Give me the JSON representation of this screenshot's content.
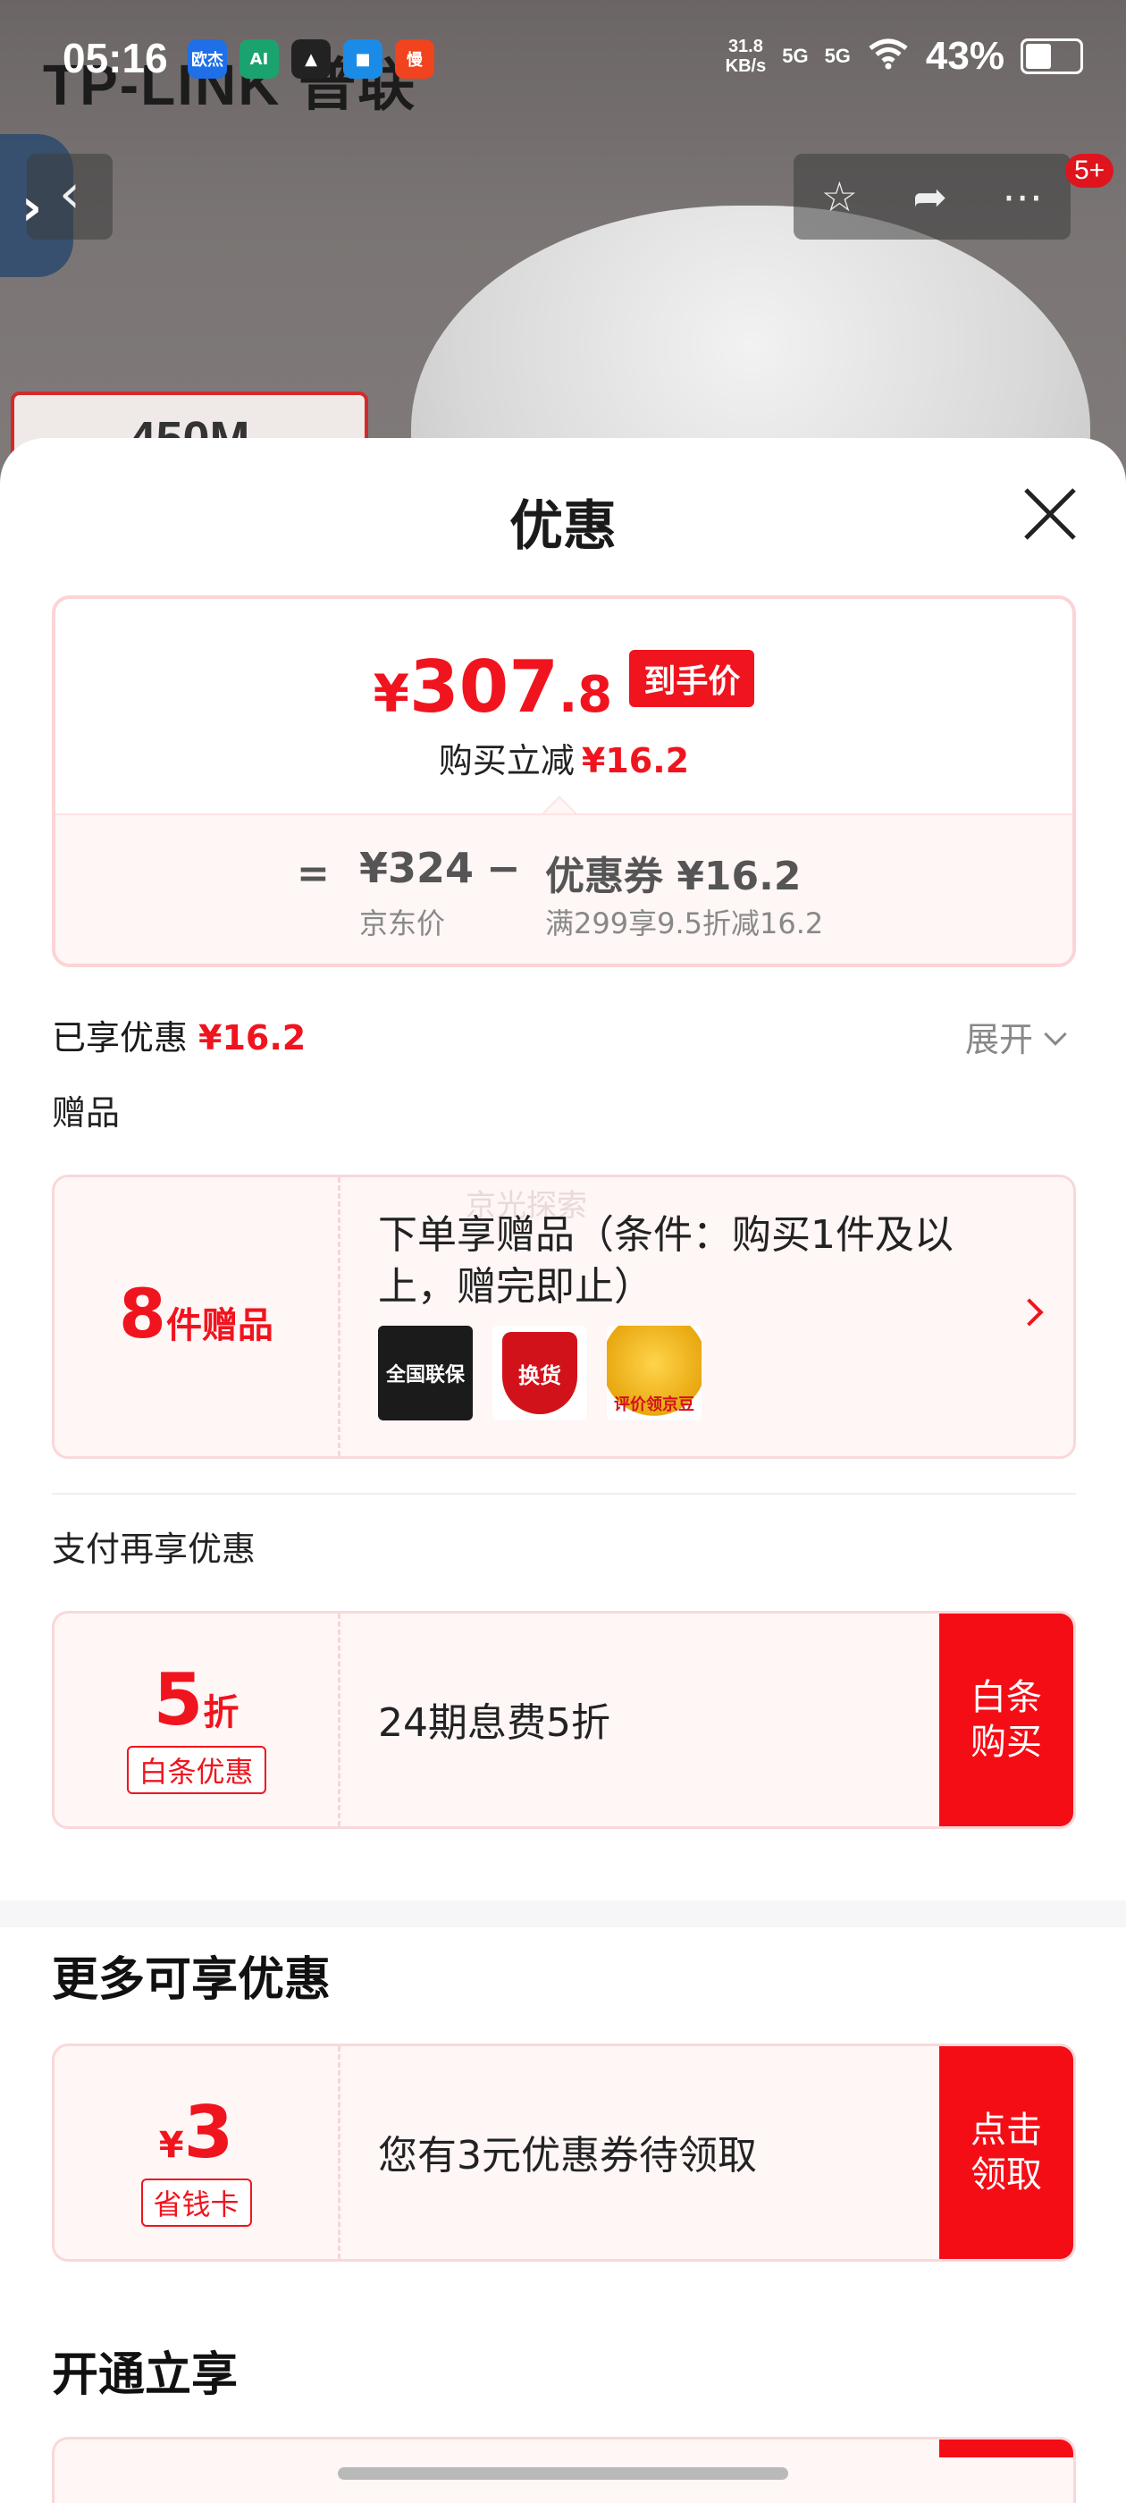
{
  "status_bar": {
    "time": "05:16",
    "apps": [
      {
        "label": "欧杰",
        "color": "#1e6fe8"
      },
      {
        "label": "AI",
        "color": "#1aa36f"
      },
      {
        "label": "▲",
        "color": "#222222"
      },
      {
        "label": "■",
        "color": "#1a8ce8"
      },
      {
        "label": "慢",
        "color": "#f0431e"
      }
    ],
    "net_speed": "31.8",
    "net_unit": "KB/s",
    "signal1": "5G",
    "signal2": "5G",
    "battery": "43%"
  },
  "background": {
    "brand": "TP-LINK 普联",
    "speed_label": "450M",
    "notification_badge": "5+"
  },
  "sheet": {
    "title": "优惠",
    "price": {
      "currency": "¥",
      "integer": "307",
      "decimal": ".8",
      "tag": "到手价",
      "instant_label": "购买立减",
      "instant_amount": "¥16.2",
      "equals": "=",
      "jd_price": "¥324",
      "jd_label": "京东价",
      "minus": "−",
      "coupon": "优惠券 ¥16.2",
      "coupon_condition": "满299享9.5折减16.2"
    },
    "enjoyed_label": "已享优惠",
    "enjoyed_amount": "¥16.2",
    "expand_label": "展开",
    "gifts_section": "赠品",
    "gift": {
      "count": "8",
      "unit": "件赠品",
      "watermark": "京光探索",
      "description": "下单享赠品（条件：购买1件及以上，赠完即止）",
      "icons": [
        {
          "name": "warranty-icon",
          "label": "全国联保"
        },
        {
          "name": "exchange-icon",
          "label": "换货"
        },
        {
          "name": "jd-beans-icon",
          "label": "评价领京豆"
        }
      ]
    },
    "pay_section": "支付再享优惠",
    "baitiao": {
      "value": "5",
      "unit": "折",
      "pill": "白条优惠",
      "text": "24期息费5折",
      "cta": "白条购买"
    },
    "more_heading": "更多可享优惠",
    "saver_card": {
      "currency": "¥",
      "value": "3",
      "pill": "省钱卡",
      "text": "您有3元优惠券待领取",
      "cta": "点击领取"
    },
    "open_heading": "开通立享"
  },
  "colors": {
    "accent": "#f0141e",
    "card_bg": "#fff6f6",
    "card_border": "#f9d8da"
  }
}
